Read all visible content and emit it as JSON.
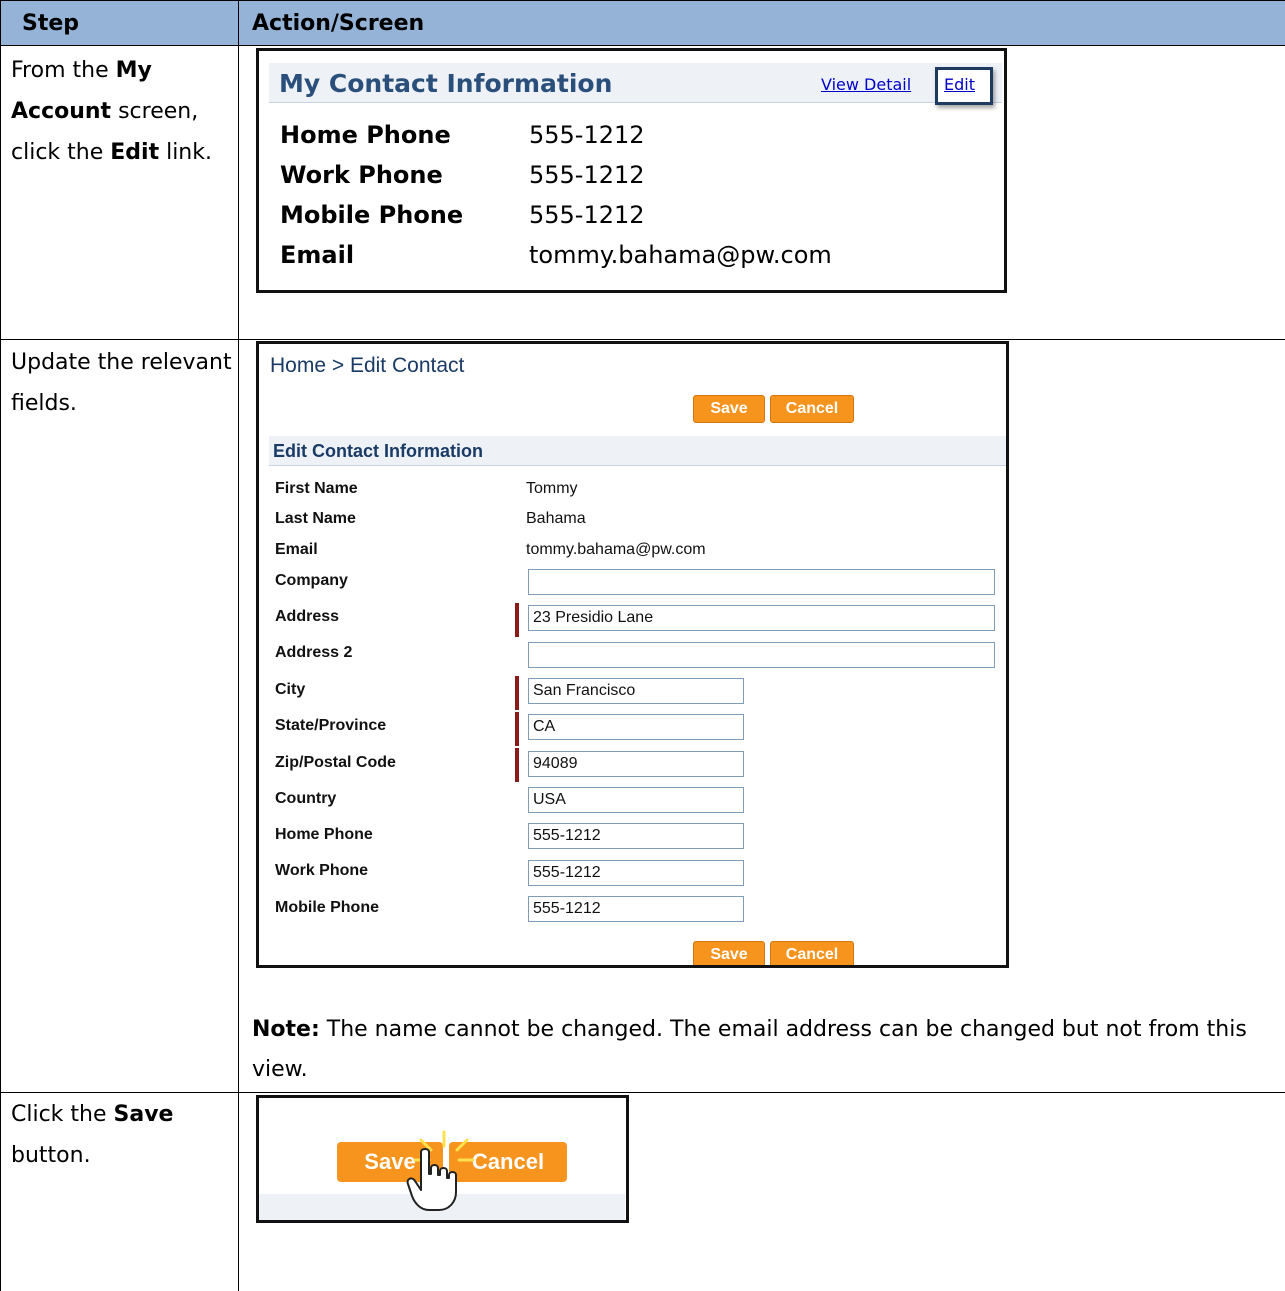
{
  "table": {
    "headers": [
      "Step",
      "Action/Screen"
    ],
    "colors": {
      "header_bg": "#95b3d7",
      "button": "#f7941d",
      "required_marker": "#8b1a1a",
      "title_blue": "#2a4f7a"
    }
  },
  "steps": [
    {
      "parts": [
        "From the ",
        "My Account",
        " screen, click the ",
        "Edit",
        " link."
      ]
    },
    {
      "text": "Update the relevant fields."
    },
    {
      "parts": [
        "Click the ",
        "Save",
        " button."
      ]
    }
  ],
  "contact_info": {
    "title": "My Contact Information",
    "view_detail_link": "View Detail",
    "edit_link": "Edit",
    "rows": [
      {
        "label": "Home Phone",
        "value": "555-1212"
      },
      {
        "label": "Work Phone",
        "value": "555-1212"
      },
      {
        "label": "Mobile Phone",
        "value": "555-1212"
      },
      {
        "label": "Email",
        "value": "tommy.bahama@pw.com"
      }
    ]
  },
  "edit_contact": {
    "breadcrumb": "Home > Edit Contact",
    "save_label": "Save",
    "cancel_label": "Cancel",
    "section_title": "Edit Contact Information",
    "static_fields": [
      {
        "label": "First Name",
        "value": "Tommy"
      },
      {
        "label": "Last Name",
        "value": "Bahama"
      },
      {
        "label": "Email",
        "value": "tommy.bahama@pw.com"
      }
    ],
    "input_fields": [
      {
        "label": "Company",
        "value": "",
        "required": false
      },
      {
        "label": "Address",
        "value": "23 Presidio Lane",
        "required": true
      },
      {
        "label": "Address 2",
        "value": "",
        "required": false
      },
      {
        "label": "City",
        "value": "San Francisco",
        "required": true
      },
      {
        "label": "State/Province",
        "value": "CA",
        "required": true
      },
      {
        "label": "Zip/Postal Code",
        "value": "94089",
        "required": true
      },
      {
        "label": "Country",
        "value": "USA",
        "required": false
      },
      {
        "label": "Home Phone",
        "value": "555-1212",
        "required": false
      },
      {
        "label": "Work Phone",
        "value": "555-1212",
        "required": false
      },
      {
        "label": "Mobile Phone",
        "value": "555-1212",
        "required": false
      }
    ]
  },
  "note": {
    "prefix": "Note:",
    "text": "  The name cannot be changed.  The email address can be changed but not from this view."
  },
  "save_shot": {
    "save_label": "Save",
    "cancel_label": "Cancel",
    "cursor_icon": "hand-pointer-icon",
    "click_burst": "click-burst-icon"
  }
}
